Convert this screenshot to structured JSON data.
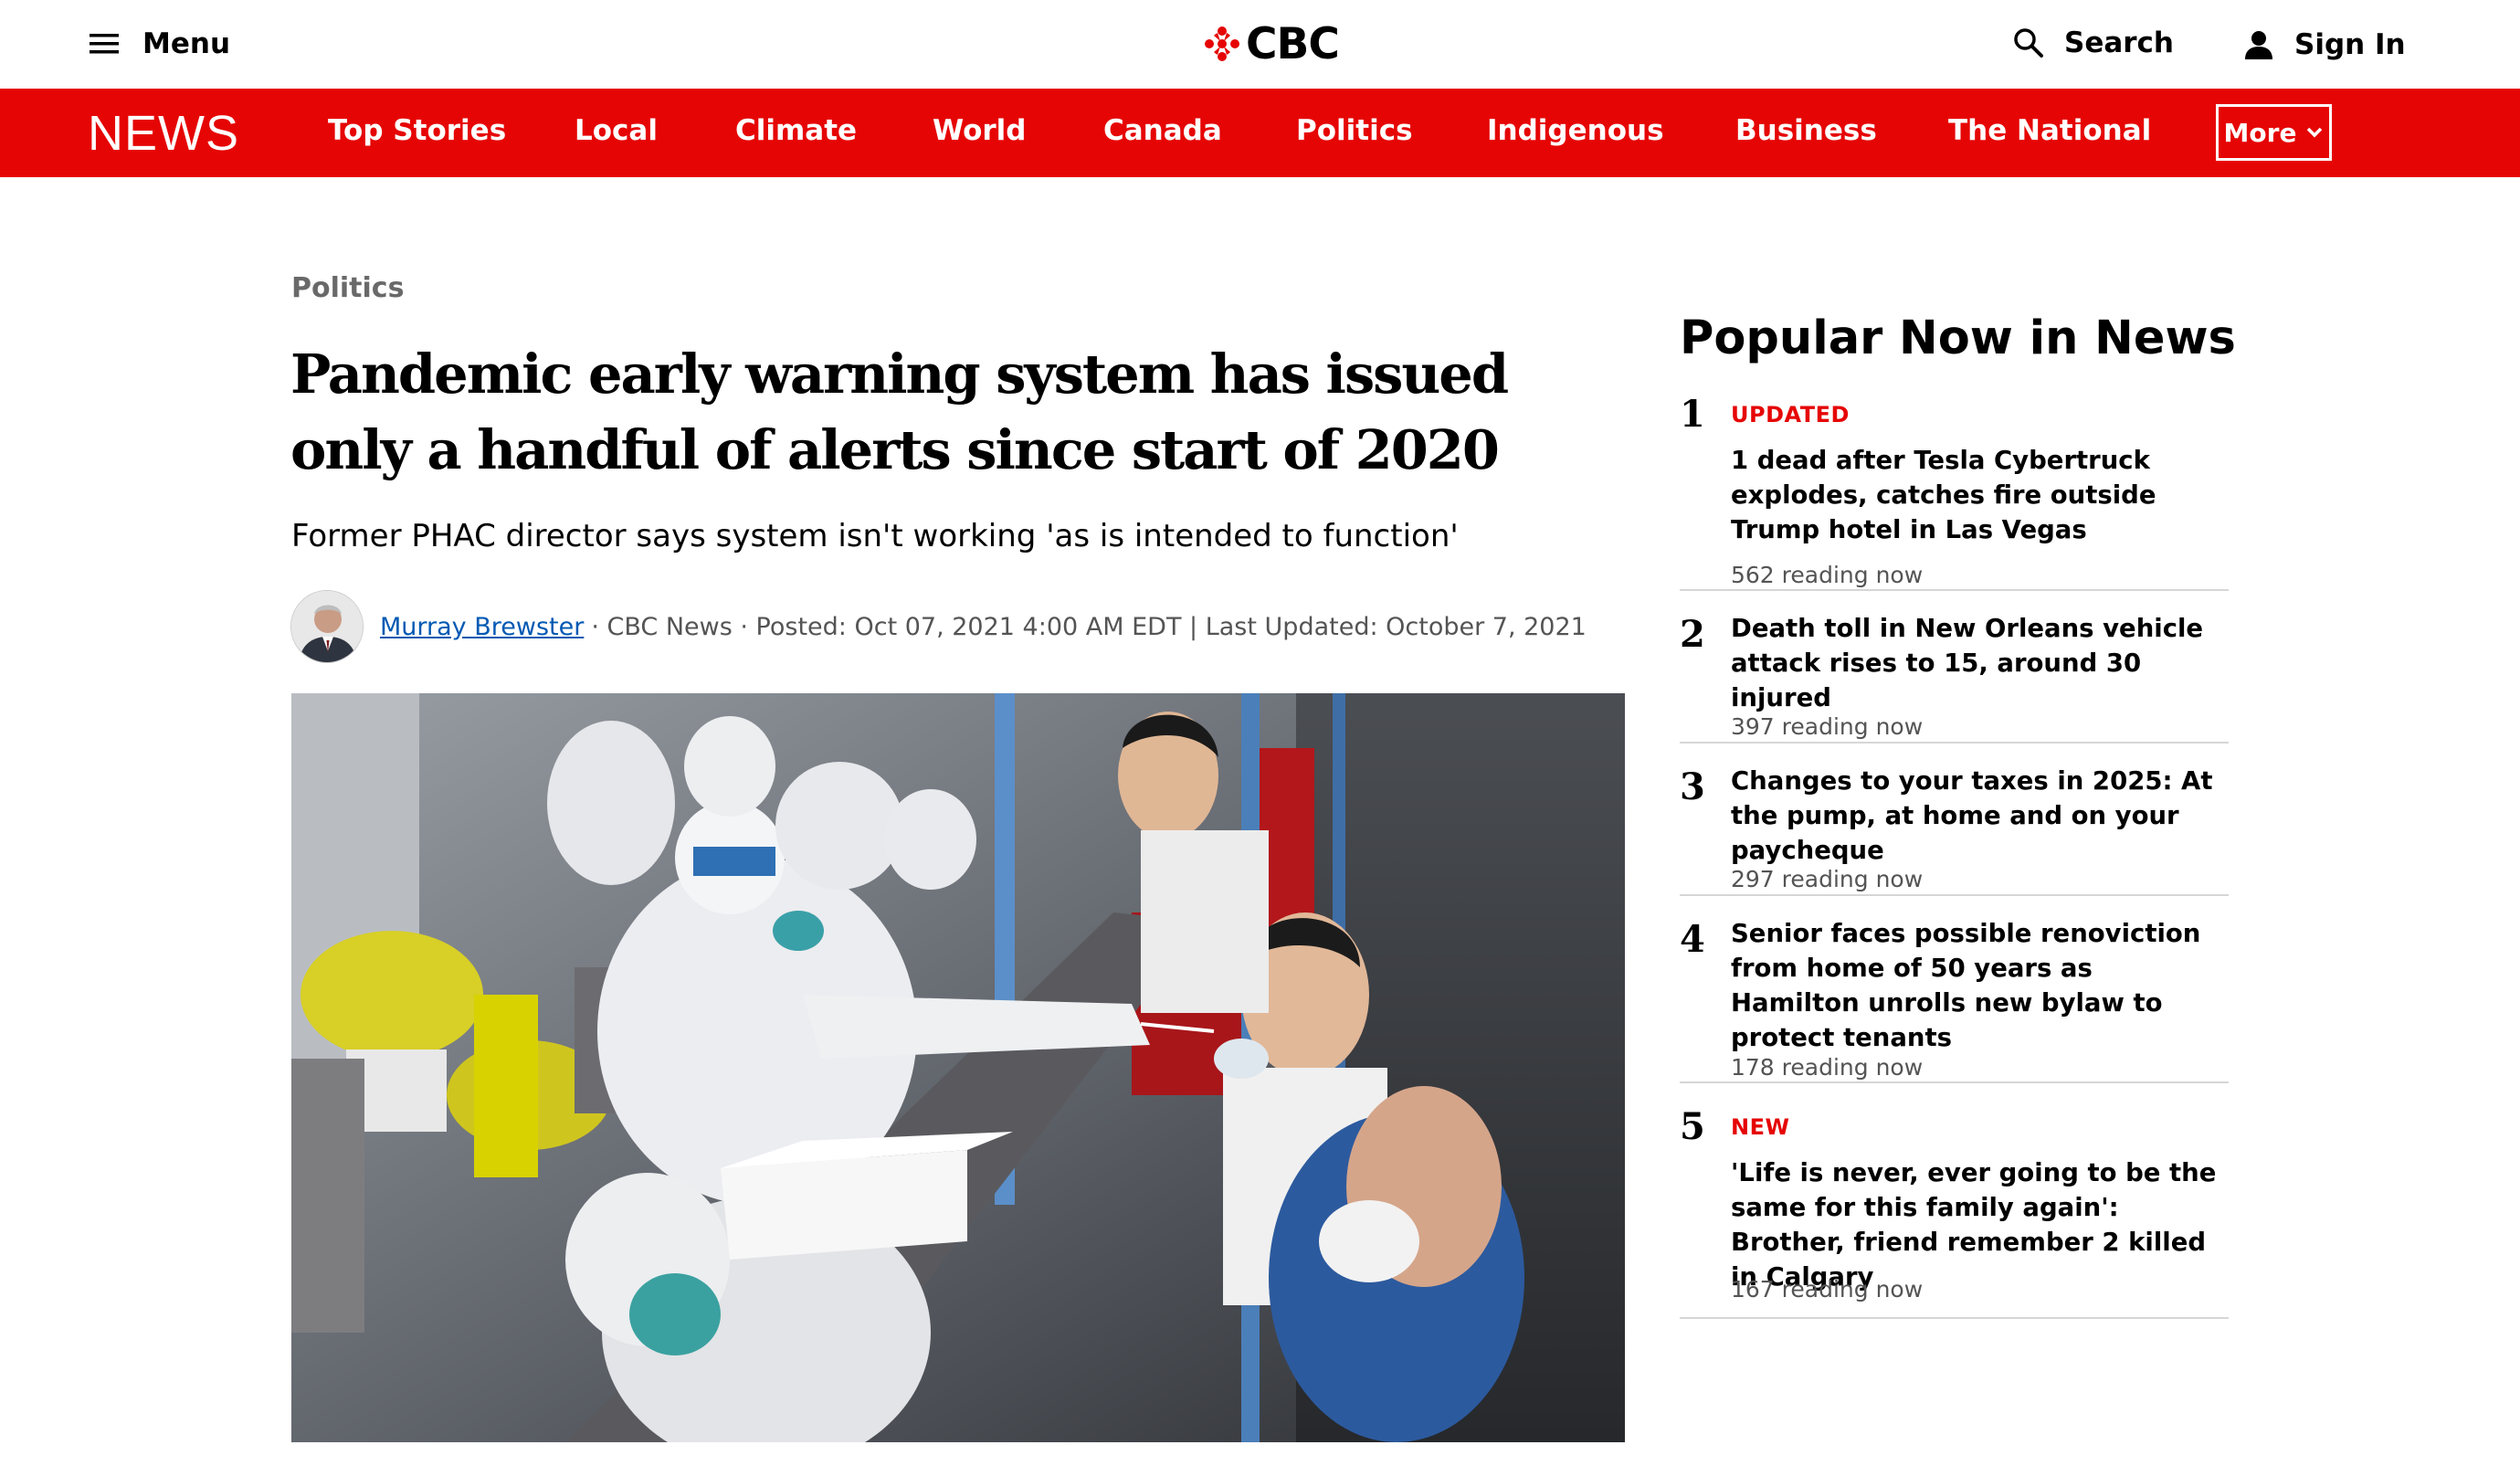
{
  "header": {
    "menu_label": "Menu",
    "logo_text": "CBC",
    "search_label": "Search",
    "signin_label": "Sign In"
  },
  "nav": {
    "brand": "NEWS",
    "items": [
      {
        "label": "Top Stories"
      },
      {
        "label": "Local"
      },
      {
        "label": "Climate"
      },
      {
        "label": "World"
      },
      {
        "label": "Canada"
      },
      {
        "label": "Politics"
      },
      {
        "label": "Indigenous"
      },
      {
        "label": "Business"
      },
      {
        "label": "The National"
      }
    ],
    "more_label": "More"
  },
  "article": {
    "section": "Politics",
    "headline": "Pandemic early warning system has issued only a handful of alerts since start of 2020",
    "deck": "Former PHAC director says system isn't working 'as is intended to function'",
    "author": "Murray Brewster",
    "meta": "· CBC News · Posted: Oct 07, 2021 4:00 AM EDT | Last Updated: October 7, 2021"
  },
  "sidebar": {
    "title": "Popular Now in News",
    "items": [
      {
        "rank": "1",
        "badge": "UPDATED",
        "headline": "1 dead after Tesla Cybertruck explodes, catches fire outside Trump hotel in Las Vegas",
        "reads": "562 reading now"
      },
      {
        "rank": "2",
        "badge": "",
        "headline": "Death toll in New Orleans vehicle attack rises to 15, around 30 injured",
        "reads": "397 reading now"
      },
      {
        "rank": "3",
        "badge": "",
        "headline": "Changes to your taxes in 2025: At the pump, at home and on your paycheque",
        "reads": "297 reading now"
      },
      {
        "rank": "4",
        "badge": "",
        "headline": "Senior faces possible renoviction from home of 50 years as Hamilton unrolls new bylaw to protect tenants",
        "reads": "178 reading now"
      },
      {
        "rank": "5",
        "badge": "NEW",
        "headline": "'Life is never, ever going to be the same for this family again': Brother, friend remember 2 killed in Calgary",
        "reads": "167 reading now"
      }
    ]
  },
  "colors": {
    "brand_red": "#e60505",
    "link_blue": "#0059b3"
  }
}
